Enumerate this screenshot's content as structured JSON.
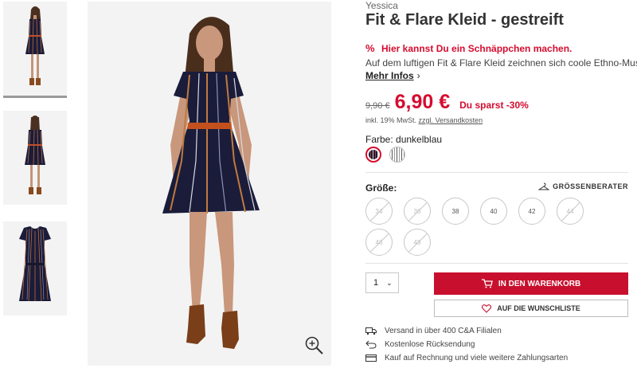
{
  "product": {
    "brand": "Yessica",
    "title": "Fit & Flare Kleid - gestreift",
    "deal_text": "Hier kannst Du ein Schnäppchen machen.",
    "description": "Auf dem luftigen Fit & Flare Kleid zeichnen sich coole Ethno-Muster ab",
    "more_info": "Mehr Infos",
    "old_price": "9,90 €",
    "new_price": "6,90 €",
    "savings": "Du sparst -30%",
    "tax_note": "inkl. 19% MwSt.",
    "shipping_link": "zzgl. Versandkosten",
    "color_label": "Farbe: dunkelblau",
    "size_label": "Größe:",
    "size_advisor": "GRÖSSENBERATER",
    "sizes": [
      {
        "label": "34",
        "available": false
      },
      {
        "label": "36",
        "available": false
      },
      {
        "label": "38",
        "available": true
      },
      {
        "label": "40",
        "available": true
      },
      {
        "label": "42",
        "available": true
      },
      {
        "label": "44",
        "available": false
      },
      {
        "label": "46",
        "available": false
      },
      {
        "label": "48",
        "available": false
      }
    ],
    "quantity": "1",
    "cart_button": "IN DEN WARENKORB",
    "wishlist_button": "AUF DIE WUNSCHLISTE"
  },
  "features": [
    {
      "icon": "truck-icon",
      "text": "Versand in über 400 C&A Filialen"
    },
    {
      "icon": "return-icon",
      "text": "Kostenlose Rücksendung"
    },
    {
      "icon": "credit-card-icon",
      "text": "Kauf auf Rechnung und viele weitere Zahlungsarten"
    }
  ],
  "colors": {
    "accent": "#c8102e",
    "price_red": "#d50c2f",
    "dress_navy": "#1a1c3a",
    "background": "#ffffff"
  }
}
